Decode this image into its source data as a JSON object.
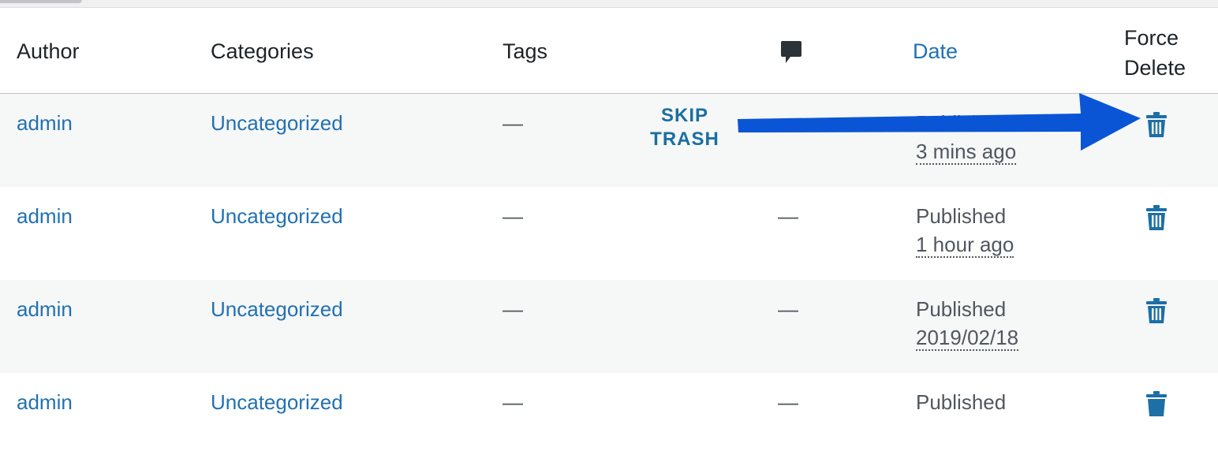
{
  "table": {
    "columns": {
      "author": "Author",
      "categories": "Categories",
      "tags": "Tags",
      "comments_icon": "comment-bubble",
      "date": "Date",
      "force_delete_line1": "Force",
      "force_delete_line2": "Delete"
    },
    "rows": [
      {
        "author": "admin",
        "category": "Uncategorized",
        "tags": "—",
        "comments": "",
        "status": "Published",
        "date": "3 mins ago"
      },
      {
        "author": "admin",
        "category": "Uncategorized",
        "tags": "—",
        "comments": "—",
        "status": "Published",
        "date": "1 hour ago"
      },
      {
        "author": "admin",
        "category": "Uncategorized",
        "tags": "—",
        "comments": "—",
        "status": "Published",
        "date": "2019/02/18"
      },
      {
        "author": "admin",
        "category": "Uncategorized",
        "tags": "—",
        "comments": "—",
        "status": "Published",
        "date": ""
      }
    ]
  },
  "annotation": {
    "line1": "SKIP",
    "line2": "TRASH",
    "arrow_color": "#0a55d6"
  },
  "colors": {
    "link": "#2271b1",
    "annotation_text": "#1a6fa0"
  }
}
